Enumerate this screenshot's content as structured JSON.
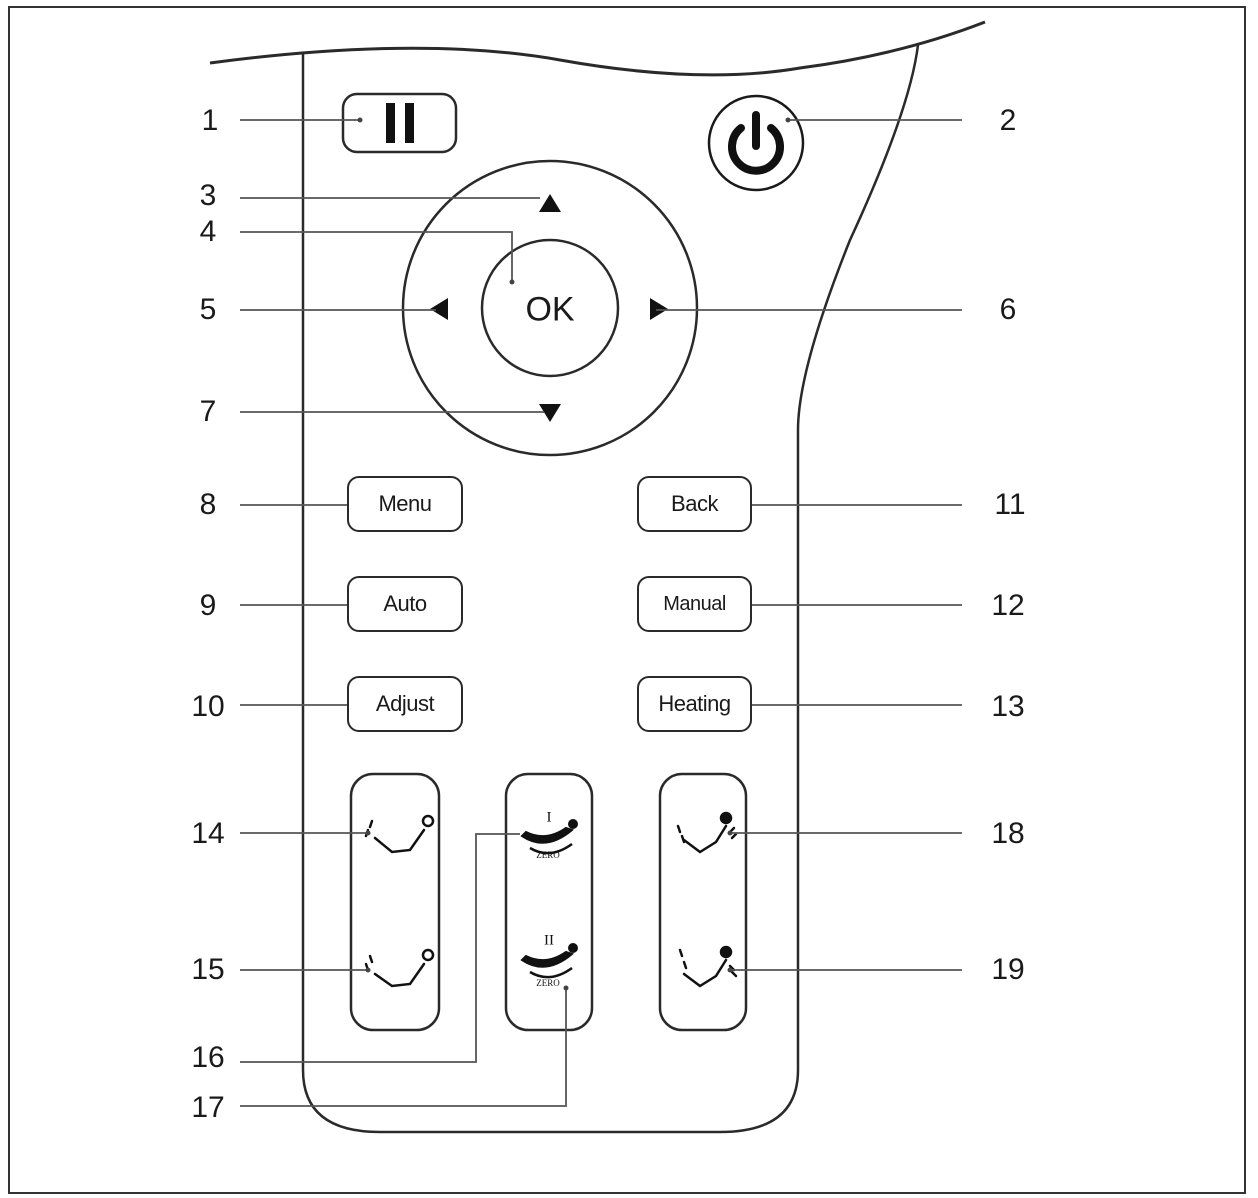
{
  "callouts": [
    "1",
    "2",
    "3",
    "4",
    "5",
    "6",
    "7",
    "8",
    "9",
    "10",
    "11",
    "12",
    "13",
    "14",
    "15",
    "16",
    "17",
    "18",
    "19"
  ],
  "buttons": {
    "ok": "OK",
    "menu": "Menu",
    "auto": "Auto",
    "adjust": "Adjust",
    "back": "Back",
    "manual": "Manual",
    "heating": "Heating",
    "zero_label": "ZERO",
    "zero_one_mark": "I",
    "zero_two_mark": "II"
  },
  "icons": {
    "pause": "pause-icon",
    "power": "power-icon",
    "up": "arrow-up-icon",
    "down": "arrow-down-icon",
    "left": "arrow-left-icon",
    "right": "arrow-right-icon",
    "backrest_up": "backrest-up-icon",
    "backrest_down": "backrest-down-icon",
    "leg_up": "leg-up-icon",
    "leg_down": "leg-down-icon"
  },
  "colors": {
    "ink": "#1a1a1a",
    "background": "#ffffff"
  }
}
